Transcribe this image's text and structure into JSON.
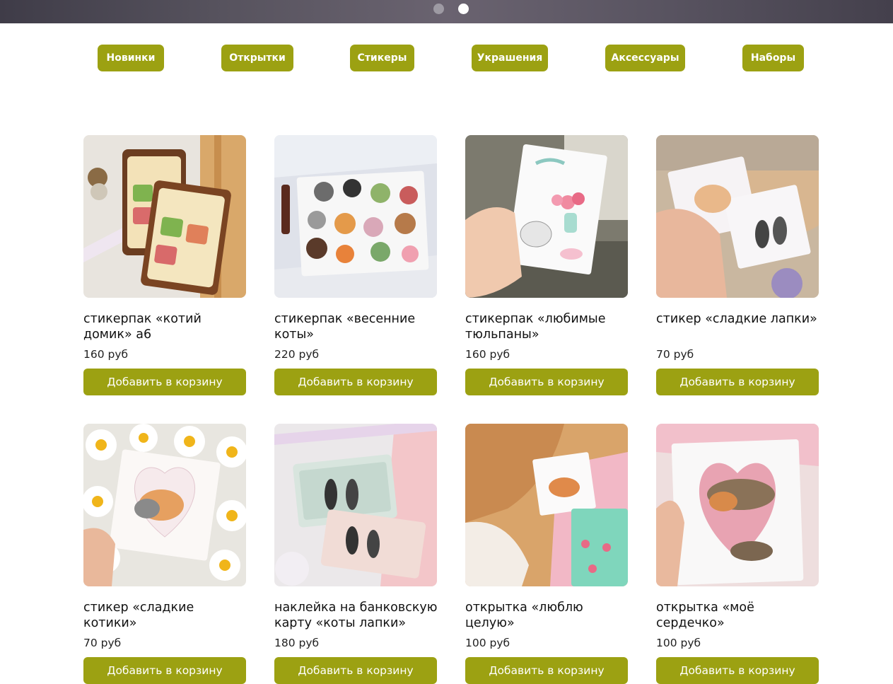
{
  "categories": [
    "Новинки",
    "Открытки",
    "Стикеры",
    "Украшения",
    "Аксессуары",
    "Наборы"
  ],
  "products": [
    {
      "title": "стикерпак «котий домик» а6",
      "price": "160 руб",
      "button": "Добавить в корзину"
    },
    {
      "title": "стикерпак «весенние коты»",
      "price": "220 руб",
      "button": "Добавить в корзину"
    },
    {
      "title": "стикерпак «любимые тюльпаны»",
      "price": "160 руб",
      "button": "Добавить в корзину"
    },
    {
      "title": "стикер «сладкие лапки»",
      "price": "70 руб",
      "button": "Добавить в корзину"
    },
    {
      "title": "стикер «сладкие котики»",
      "price": "70 руб",
      "button": "Добавить в корзину"
    },
    {
      "title": "наклейка на банковскую карту «коты лапки»",
      "price": "180 руб",
      "button": "Добавить в корзину"
    },
    {
      "title": "открытка «люблю целую»",
      "price": "100 руб",
      "button": "Добавить в корзину"
    },
    {
      "title": "открытка «моё сердечко»",
      "price": "100 руб",
      "button": "Добавить в корзину"
    }
  ],
  "colors": {
    "accent": "#9ca112",
    "text": "#111111"
  },
  "slider": {
    "slides": 2,
    "active": 2
  }
}
